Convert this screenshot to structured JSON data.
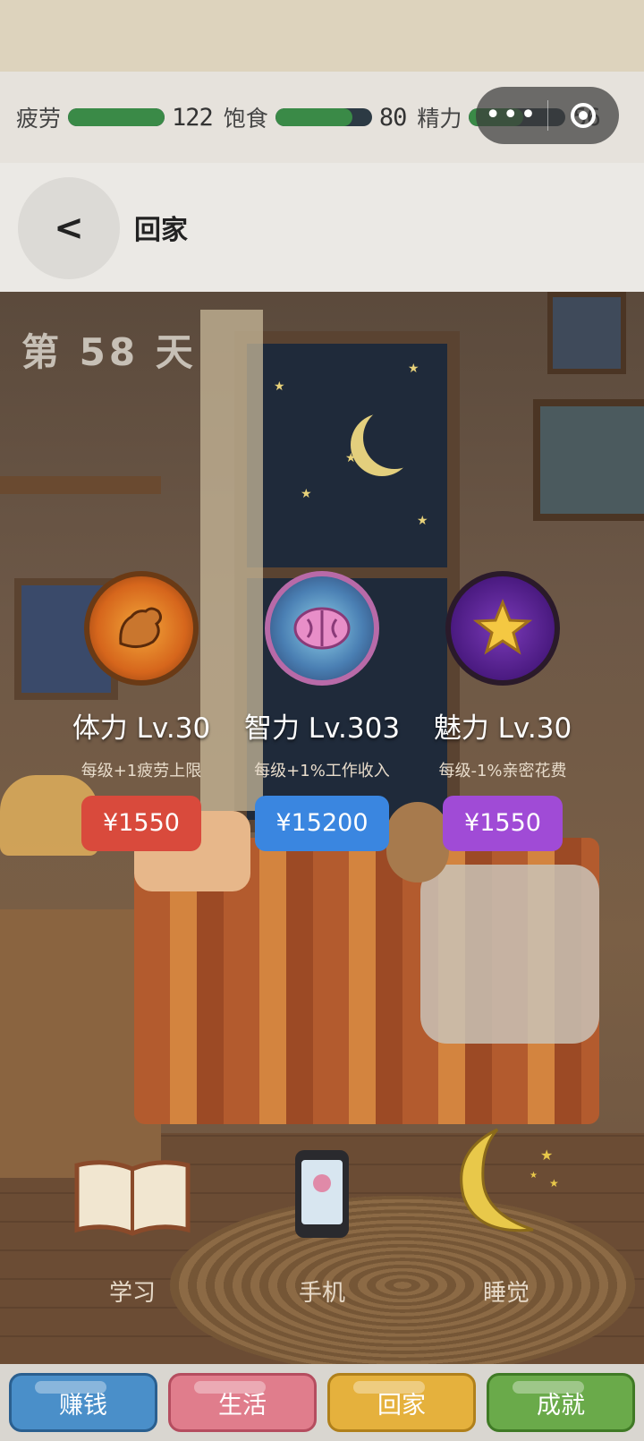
{
  "stats": [
    {
      "label": "疲劳",
      "value": "122",
      "level": 1.0
    },
    {
      "label": "饱食",
      "value": "80",
      "level": 0.8
    },
    {
      "label": "精力",
      "value": "56",
      "level": 0.56
    }
  ],
  "capsule": {
    "more_icon": "ellipsis-icon",
    "close_icon": "target-icon"
  },
  "nav": {
    "back": "<",
    "title": "回家"
  },
  "scene": {
    "day": "第 58 天"
  },
  "skills": [
    {
      "icon": "flexing-arm-icon",
      "name": "体力 Lv.30",
      "desc": "每级+1疲劳上限",
      "price": "¥1550",
      "color": "#d94a3c"
    },
    {
      "icon": "brain-icon",
      "name": "智力 Lv.303",
      "desc": "每级+1%工作收入",
      "price": "¥15200",
      "color": "#3a86e0"
    },
    {
      "icon": "star-icon",
      "name": "魅力 Lv.30",
      "desc": "每级-1%亲密花费",
      "price": "¥1550",
      "color": "#a04bd6"
    }
  ],
  "actions": [
    {
      "icon": "book-icon",
      "label": "学习"
    },
    {
      "icon": "phone-icon",
      "label": "手机"
    },
    {
      "icon": "moon-icon",
      "label": "睡觉"
    }
  ],
  "tabs": [
    {
      "label": "赚钱",
      "color": "#4a8fc9"
    },
    {
      "label": "生活",
      "color": "#e07d8c"
    },
    {
      "label": "回家",
      "color": "#e5b13d"
    },
    {
      "label": "成就",
      "color": "#6aaa4a"
    }
  ]
}
